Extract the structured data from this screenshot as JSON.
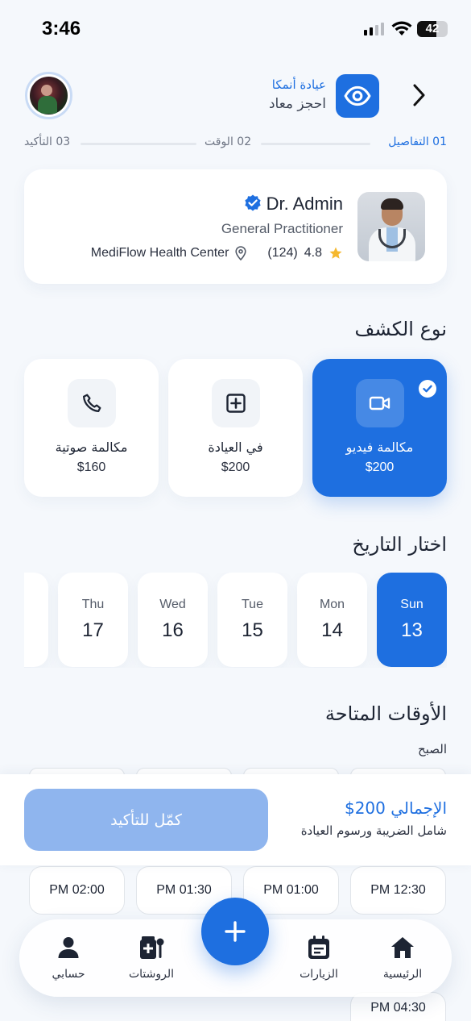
{
  "status_bar": {
    "time": "3:46",
    "battery": "42"
  },
  "header": {
    "clinic_name": "عيادة أنمكا",
    "subtitle": "احجز معاد",
    "logo_icon": "eye-icon",
    "back_icon": "chevron-right-icon"
  },
  "stepper": {
    "steps": [
      {
        "label": "01 التفاصيل",
        "active": true
      },
      {
        "label": "02 الوقت",
        "active": false
      },
      {
        "label": "03 التأكيد",
        "active": false
      }
    ]
  },
  "doctor": {
    "name": "Dr. Admin",
    "specialty": "General Practitioner",
    "rating": "4.8",
    "reviews": "(124)",
    "location": "MediFlow Health Center"
  },
  "consult_type": {
    "title": "نوع الكشف",
    "options": [
      {
        "label": "مكالمة فيديو",
        "price": "$200",
        "icon": "video-camera-icon",
        "selected": true
      },
      {
        "label": "في العيادة",
        "price": "$200",
        "icon": "medical-plus-icon",
        "selected": false
      },
      {
        "label": "مكالمة صوتية",
        "price": "$160",
        "icon": "phone-icon",
        "selected": false
      }
    ]
  },
  "dates": {
    "title": "اختار التاريخ",
    "days": [
      {
        "day": "Sun",
        "num": "13",
        "selected": true
      },
      {
        "day": "Mon",
        "num": "14",
        "selected": false
      },
      {
        "day": "Tue",
        "num": "15",
        "selected": false
      },
      {
        "day": "Wed",
        "num": "16",
        "selected": false
      },
      {
        "day": "Thu",
        "num": "17",
        "selected": false
      }
    ]
  },
  "times": {
    "title": "الأوقات المتاحة",
    "period": "الصبح",
    "slots": [
      "PM 12:30",
      "PM 01:00",
      "PM 01:30",
      "PM 02:00"
    ],
    "peek_slot": "PM 04:30"
  },
  "summary": {
    "total": "الإجمالي 200$",
    "note": "شامل الضريبة ورسوم العيادة",
    "confirm": "كمّل للتأكيد"
  },
  "nav": {
    "items": [
      {
        "label": "الرئيسية",
        "icon": "home-icon"
      },
      {
        "label": "الزيارات",
        "icon": "calendar-icon"
      },
      {
        "label": "الروشتات",
        "icon": "prescription-icon"
      },
      {
        "label": "حسابي",
        "icon": "person-icon"
      }
    ],
    "fab_icon": "plus-icon"
  },
  "colors": {
    "primary": "#1e6fe0",
    "confirm_disabled": "#8fb5ee",
    "background": "#f5f8fc"
  }
}
